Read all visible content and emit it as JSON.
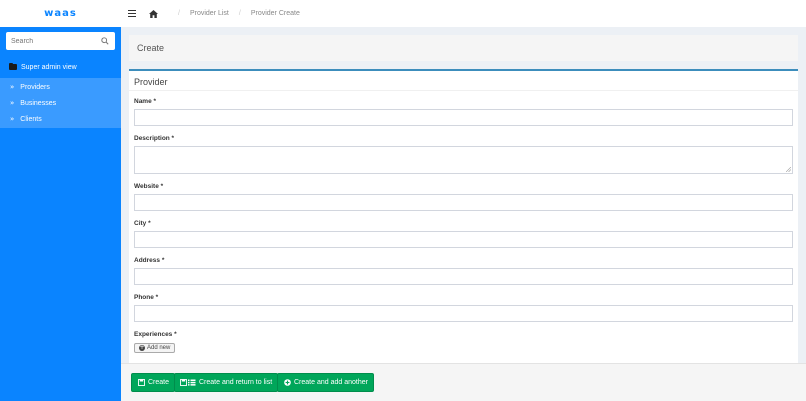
{
  "app": {
    "logo": "waas"
  },
  "search": {
    "placeholder": "Search"
  },
  "sidebar": {
    "header": "Super admin view",
    "items": [
      {
        "label": "Providers"
      },
      {
        "label": "Businesses"
      },
      {
        "label": "Clients"
      }
    ]
  },
  "breadcrumb": {
    "items": [
      "Provider List",
      "Provider Create"
    ]
  },
  "page": {
    "title": "Create"
  },
  "form": {
    "title": "Provider",
    "fields": [
      {
        "label": "Name *",
        "value": ""
      },
      {
        "label": "Description *",
        "value": ""
      },
      {
        "label": "Website *",
        "value": ""
      },
      {
        "label": "City *",
        "value": ""
      },
      {
        "label": "Address *",
        "value": ""
      },
      {
        "label": "Phone *",
        "value": ""
      },
      {
        "label": "Experiences *"
      }
    ],
    "add_new_label": "Add new"
  },
  "actions": {
    "create": "Create",
    "create_return": "Create and return to list",
    "create_add": "Create and add another"
  },
  "colors": {
    "sidebar": "#0a84ff",
    "primary_button": "#00a65a",
    "box_border": "#3c8dbc"
  }
}
